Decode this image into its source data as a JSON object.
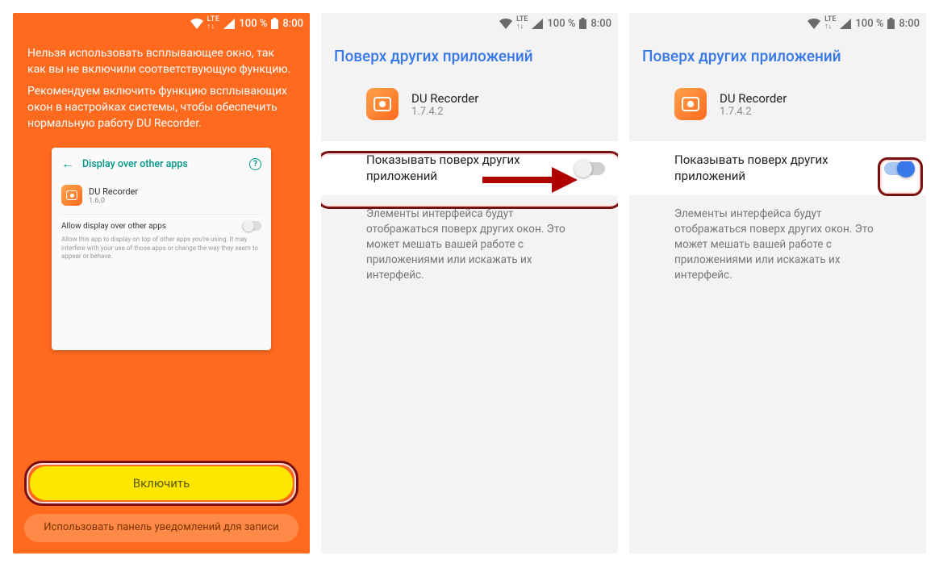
{
  "status": {
    "network": "LTE",
    "battery_pct": "100 %",
    "time": "8:00"
  },
  "screen1": {
    "msg1": "Нельзя использовать всплывающее окно, так как вы не включили соответствующую функцию.",
    "msg2": "Рекомендуем включить функцию всплывающих окон в настройках системы, чтобы обеспечить нормальную работу DU Recorder.",
    "card": {
      "title": "Display over other apps",
      "app": "DU Recorder",
      "ver": "1.6.0",
      "allow": "Allow display over other apps",
      "desc": "Allow this app to display on top of other apps you're using. It may interfere with your use of those apps or change the way they seem to appear or behave."
    },
    "enable": "Включить",
    "secondary": "Использовать панель уведомлений для записи"
  },
  "settings": {
    "title": "Поверх других приложений",
    "app": "DU Recorder",
    "ver": "1.7.4.2",
    "toggle": "Показывать поверх других приложений",
    "desc": "Элементы интерфейса будут отображаться поверх других окон. Это может мешать вашей работе с приложениями или искажать их интерфейс."
  }
}
